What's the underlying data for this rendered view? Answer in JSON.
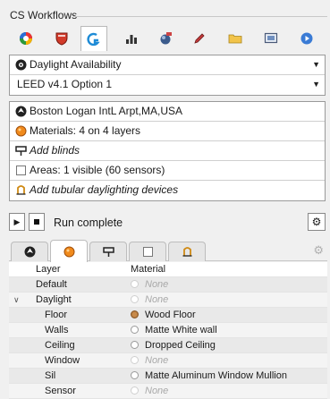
{
  "window": {
    "title": "CS Workflows"
  },
  "toolbar": {
    "icons": [
      "daylight-icon",
      "shield-icon",
      "analysis-icon",
      "bar-chart-icon",
      "render-icon",
      "edit-icon",
      "folder-icon",
      "monitor-icon",
      "play-icon"
    ],
    "active_index": 2
  },
  "metric": {
    "name": "Daylight Availability",
    "standard": "LEED v4.1 Option 1"
  },
  "settings": {
    "location": "Boston Logan IntL Arpt,MA,USA",
    "materials": "Materials: 4 on 4 layers",
    "blinds": "Add blinds",
    "areas": "Areas: 1 visible (60 sensors)",
    "tdd": "Add tubular daylighting devices"
  },
  "run": {
    "status": "Run complete"
  },
  "subtabs": {
    "items": [
      "location-icon",
      "materials-icon",
      "blinds-icon",
      "areas-icon",
      "tdd-icon"
    ],
    "active_index": 1
  },
  "materials_table": {
    "headers": {
      "layer": "Layer",
      "material": "Material"
    },
    "rows": [
      {
        "layer": "Default",
        "material": "None",
        "assigned": false
      },
      {
        "layer": "Daylight",
        "material": "None",
        "assigned": false
      },
      {
        "layer": "Floor",
        "material": "Wood Floor",
        "assigned": true
      },
      {
        "layer": "Walls",
        "material": "Matte White wall",
        "assigned": true
      },
      {
        "layer": "Ceiling",
        "material": "Dropped Ceiling",
        "assigned": true
      },
      {
        "layer": "Window",
        "material": "None",
        "assigned": false
      },
      {
        "layer": "Sil",
        "material": "Matte Aluminum Window Mullion",
        "assigned": true
      },
      {
        "layer": "Sensor",
        "material": "None",
        "assigned": false
      }
    ]
  },
  "colors": {
    "accent_blue": "#1e8bd6",
    "wood": "#b07030",
    "border": "#9a9a9a"
  }
}
